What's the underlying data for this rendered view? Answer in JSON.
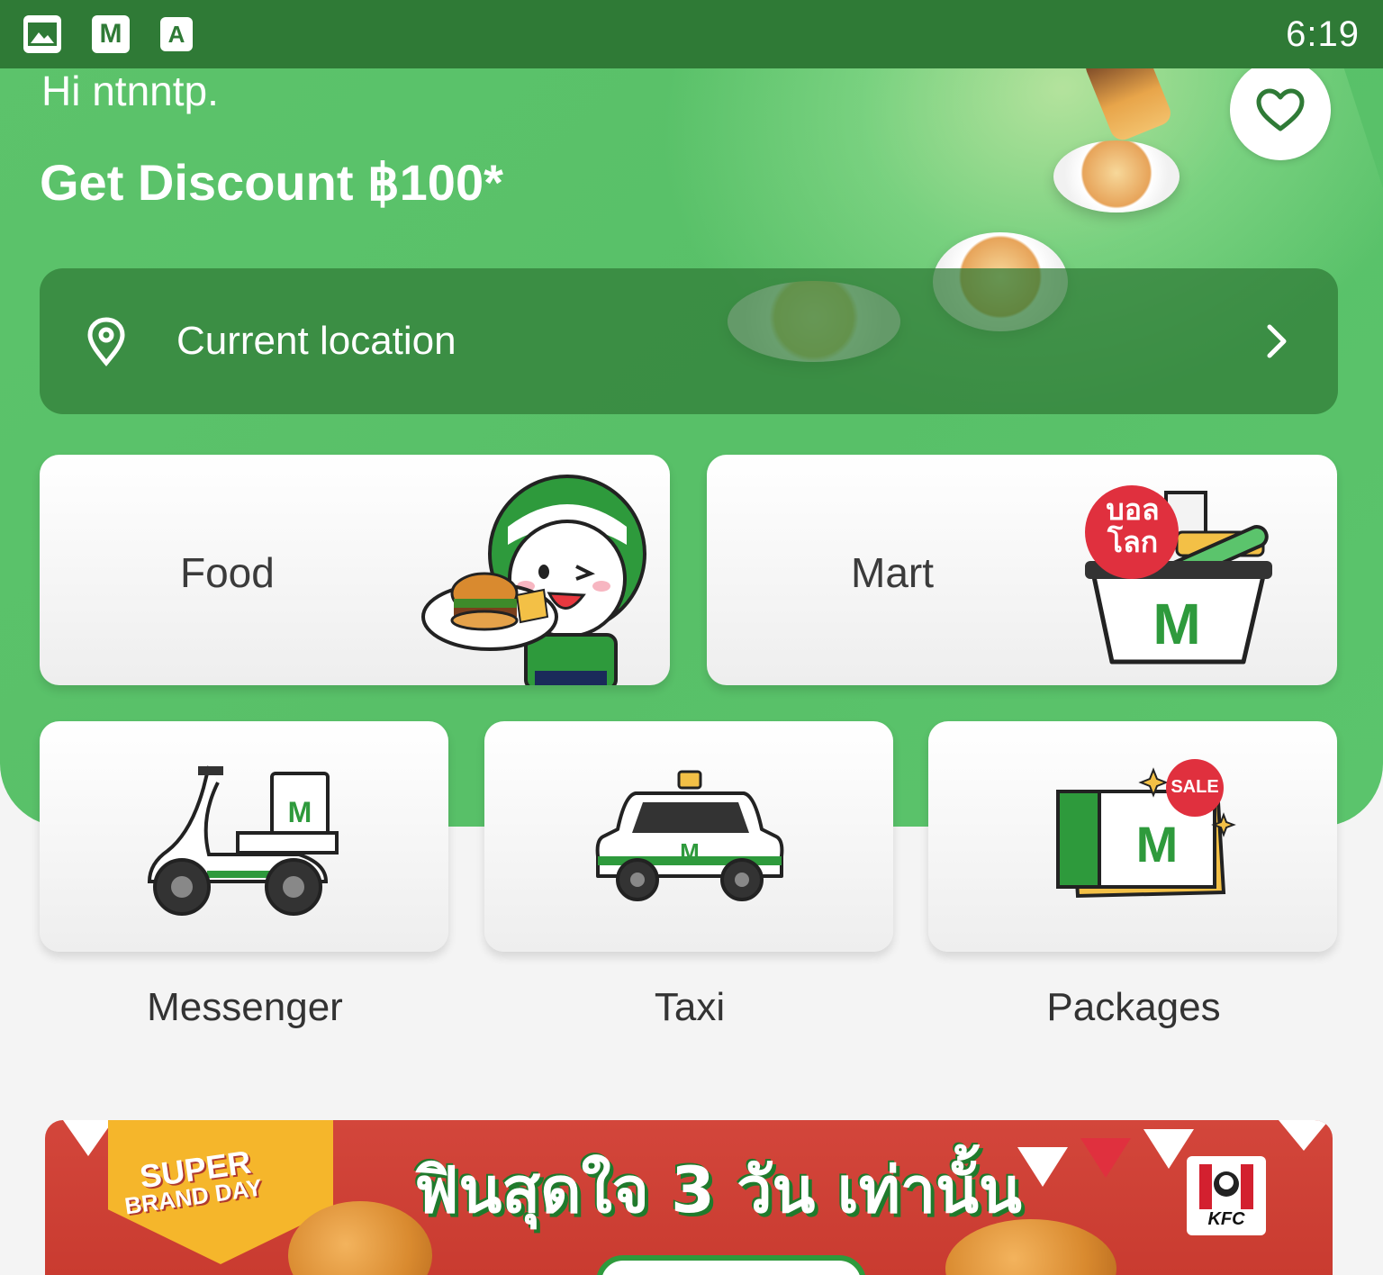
{
  "status_bar": {
    "time": "6:19",
    "icons": [
      "gallery-icon",
      "lineman-app-icon",
      "app-a-icon"
    ],
    "icon_m": "M",
    "icon_a": "A"
  },
  "header": {
    "greeting": "Hi ntnntp.",
    "promo": "Get Discount ฿100*",
    "favorite_icon": "heart-icon"
  },
  "location": {
    "label": "Current location",
    "icon": "location-pin-icon",
    "chevron_icon": "chevron-right-icon"
  },
  "services_main": [
    {
      "label": "Food"
    },
    {
      "label": "Mart",
      "badge_line1": "บอล",
      "badge_line2": "โลก"
    }
  ],
  "services_secondary": [
    {
      "label": "Messenger",
      "icon": "scooter-icon"
    },
    {
      "label": "Taxi",
      "icon": "taxi-icon"
    },
    {
      "label": "Packages",
      "icon": "voucher-icon",
      "badge": "SALE"
    }
  ],
  "banner": {
    "badge_line1": "SUPER",
    "badge_line2": "BRAND DAY",
    "headline": "ฟินสุดใจ 3 วัน เท่านั้น",
    "brand": "KFC"
  },
  "colors": {
    "brand_green": "#5cc36b",
    "status_bar": "#2f7a36",
    "banner_red": "#d3463b",
    "sale_red": "#e0303e"
  }
}
